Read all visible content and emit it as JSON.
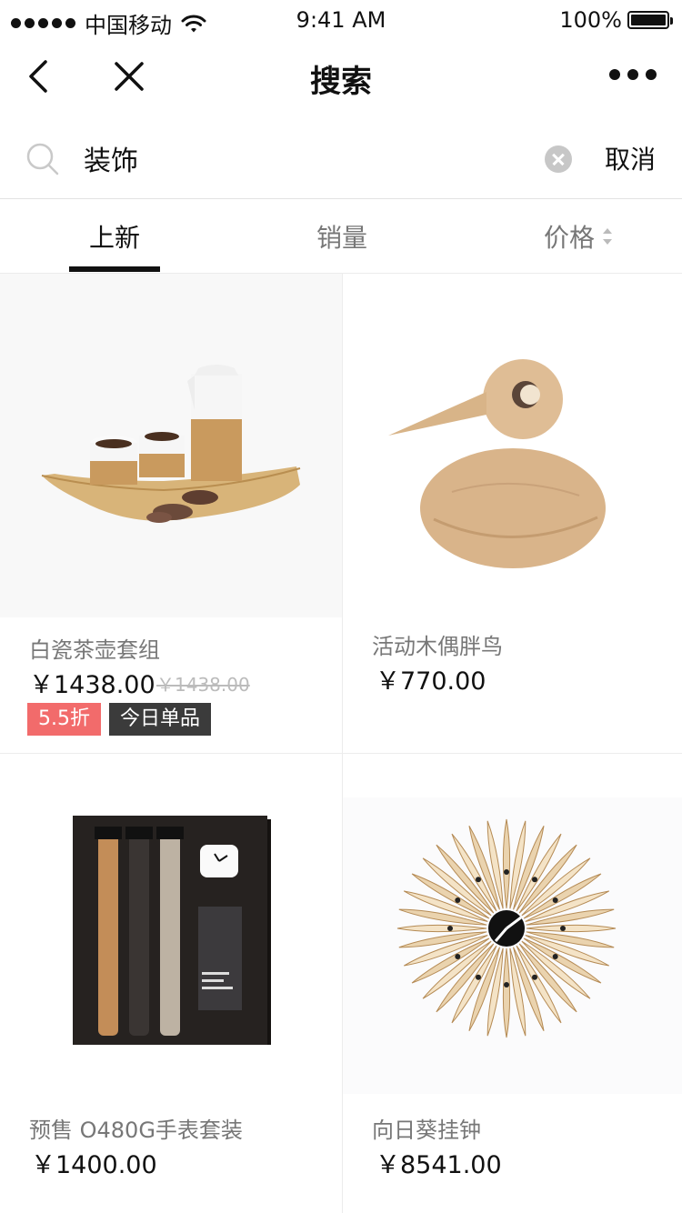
{
  "status_bar": {
    "carrier": "中国移动",
    "time": "9:41 AM",
    "battery": "100%"
  },
  "nav": {
    "title": "搜索"
  },
  "search": {
    "query": "装饰",
    "cancel_label": "取消"
  },
  "tabs": [
    {
      "label": "上新",
      "active": true
    },
    {
      "label": "销量",
      "active": false
    },
    {
      "label": "价格",
      "active": false
    }
  ],
  "products": [
    {
      "name": "白瓷茶壶套组",
      "price": "￥1438.00",
      "original_price": "￥1438.00",
      "tags": [
        "5.5折",
        "今日单品"
      ],
      "image": "tea-set-image"
    },
    {
      "name": "活动木偶胖鸟",
      "price": "￥770.00",
      "image": "wooden-bird-image"
    },
    {
      "name": "预售 O480G手表套装",
      "price": "￥1400.00",
      "image": "watch-set-image"
    },
    {
      "name": "向日葵挂钟",
      "price": "￥8541.00",
      "image": "sunflower-clock-image"
    }
  ],
  "colors": {
    "discount_tag": "#f26b6b",
    "daily_tag": "#3b3b3b",
    "tab_indicator": "#111111"
  }
}
